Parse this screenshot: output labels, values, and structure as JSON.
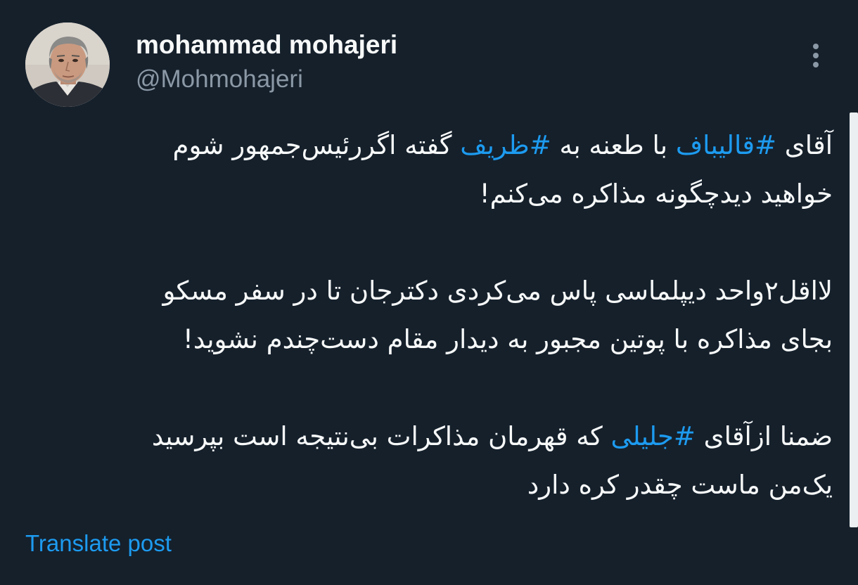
{
  "author": {
    "display_name": "mohammad mohajeri",
    "handle": "@Mohmohajeri"
  },
  "tweet": {
    "paragraphs": [
      [
        [
          {
            "text": "آقای ",
            "hashtag": false
          },
          {
            "text": "#قالیباف",
            "hashtag": true
          },
          {
            "text": " با طعنه به ",
            "hashtag": false
          },
          {
            "text": "#ظریف",
            "hashtag": true
          },
          {
            "text": " گفته اگررئیس‌جمهور شوم",
            "hashtag": false
          }
        ],
        [
          {
            "text": "خواهید دیدچگونه مذاکره می‌کنم!",
            "hashtag": false
          }
        ]
      ],
      [
        [
          {
            "text": "لااقل۲واحد دیپلماسی پاس می‌کردی دکترجان تا در سفر مسکو",
            "hashtag": false
          }
        ],
        [
          {
            "text": "بجای مذاکره با پوتین مجبور به دیدار مقام دست‌چندم نشوید!",
            "hashtag": false
          }
        ]
      ],
      [
        [
          {
            "text": "ضمنا ازآقای ",
            "hashtag": false
          },
          {
            "text": "#جلیلی",
            "hashtag": true
          },
          {
            "text": " که قهرمان مذاکرات بی‌نتیجه است بپرسید",
            "hashtag": false
          }
        ],
        [
          {
            "text": "یک‌من ماست چقدر کره دارد",
            "hashtag": false
          }
        ]
      ]
    ]
  },
  "actions": {
    "translate_label": "Translate post"
  },
  "icons": {
    "more": "more-vertical-icon",
    "avatar": "profile-photo"
  },
  "colors": {
    "background": "#15202b",
    "text": "#f7f9f9",
    "secondary_text": "#8b98a5",
    "accent": "#1d9bf0"
  }
}
